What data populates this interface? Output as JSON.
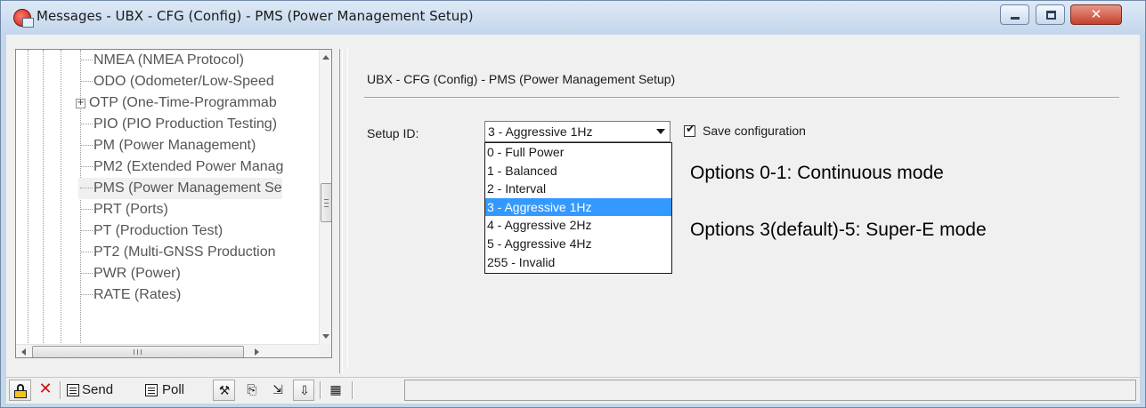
{
  "window": {
    "title": "Messages - UBX - CFG (Config) - PMS (Power Management Setup)",
    "minimize_glyph": "",
    "maximize_glyph": "",
    "close_glyph": "✕"
  },
  "tree": {
    "items": [
      {
        "label": "NMEA (NMEA Protocol)",
        "expandable": false
      },
      {
        "label": "ODO (Odometer/Low-Speed",
        "expandable": false
      },
      {
        "label": "OTP (One-Time-Programmab",
        "expandable": true,
        "expander": "+"
      },
      {
        "label": "PIO (PIO Production Testing)",
        "expandable": false
      },
      {
        "label": "PM (Power Management)",
        "expandable": false
      },
      {
        "label": "PM2 (Extended Power Manag",
        "expandable": false
      },
      {
        "label": "PMS (Power Management Se",
        "expandable": false,
        "selected": true
      },
      {
        "label": "PRT (Ports)",
        "expandable": false
      },
      {
        "label": "PT (Production Test)",
        "expandable": false
      },
      {
        "label": "PT2 (Multi-GNSS Production",
        "expandable": false
      },
      {
        "label": "PWR (Power)",
        "expandable": false
      },
      {
        "label": "RATE (Rates)",
        "expandable": false
      }
    ],
    "hscroll_grip": "III"
  },
  "config": {
    "title": "UBX - CFG (Config) - PMS (Power Management Setup)",
    "setup_label": "Setup ID:",
    "setup_value": "3 - Aggressive 1Hz",
    "options": [
      "0 - Full Power",
      "1 - Balanced",
      "2 - Interval",
      "3 - Aggressive 1Hz",
      "4 - Aggressive 2Hz",
      "5 - Aggressive 4Hz",
      "255 - Invalid"
    ],
    "selected_option_index": 3,
    "save_checked": true,
    "save_label": "Save configuration",
    "note1": "Options 0-1: Continuous mode",
    "note2": "Options 3(default)-5: Super-E mode"
  },
  "toolbar": {
    "send_label": "Send",
    "poll_label": "Poll",
    "icons": [
      "lock-icon",
      "delete-icon",
      "send-icon",
      "poll-icon",
      "tools-icon",
      "copy-icon",
      "import-icon",
      "export-icon",
      "device-icon"
    ]
  },
  "colors": {
    "selection": "#3399ff",
    "title_bar": "#c5d6ea",
    "close_button": "#c4412c"
  }
}
